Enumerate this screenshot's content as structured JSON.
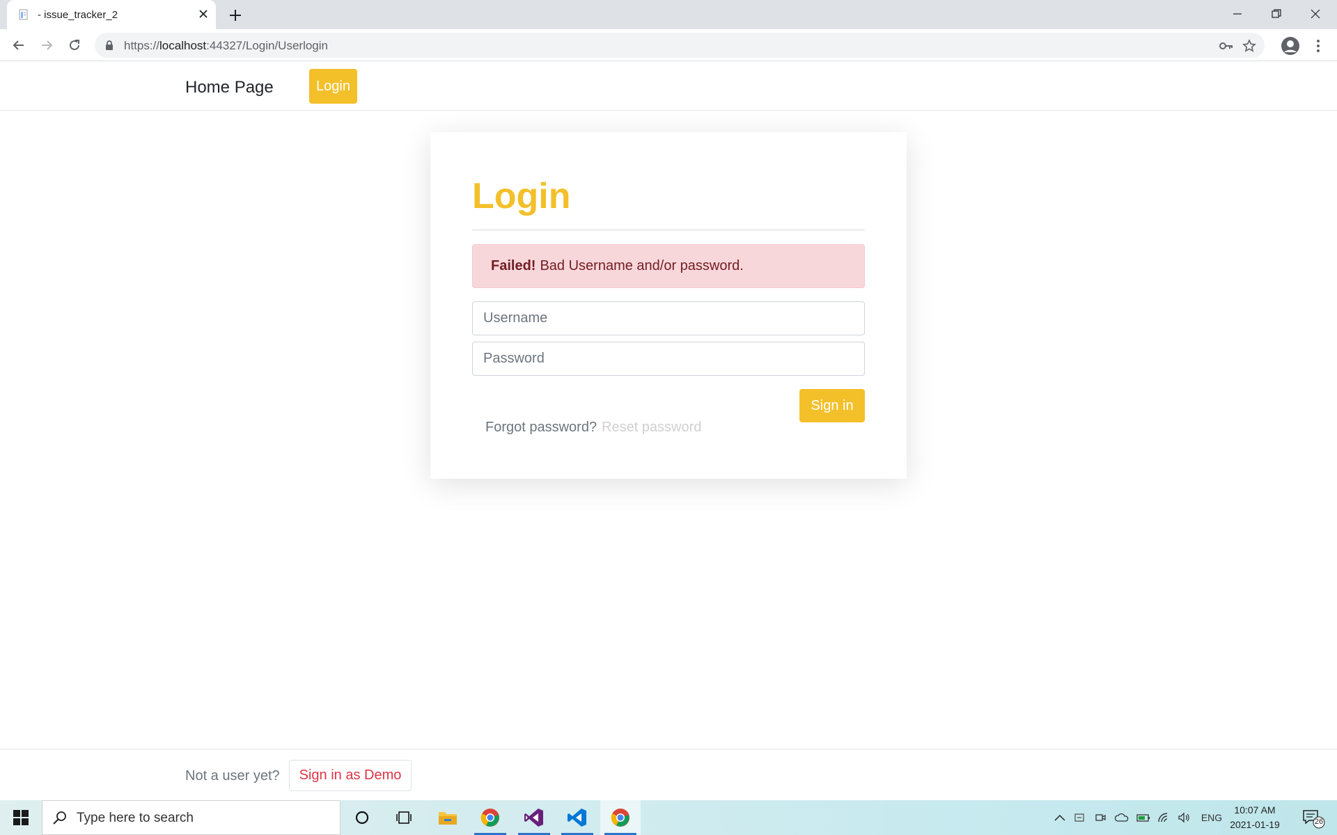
{
  "browser": {
    "tab_title": "- issue_tracker_2",
    "url_scheme": "https://",
    "url_host": "localhost",
    "url_rest": ":44327/Login/Userlogin"
  },
  "navbar": {
    "brand": "Home Page",
    "login_label": "Login"
  },
  "card": {
    "title": "Login",
    "alert_strong": "Failed!",
    "alert_text": "Bad Username and/or password.",
    "username_placeholder": "Username",
    "password_placeholder": "Password",
    "signin_label": "Sign in",
    "forgot_text": "Forgot password?",
    "reset_link": "Reset password"
  },
  "footer": {
    "text": "Not a user yet?",
    "demo_label": "Sign in as Demo"
  },
  "taskbar": {
    "search_placeholder": "Type here to search",
    "language": "ENG",
    "time": "10:07 AM",
    "date": "2021-01-19",
    "notification_count": "26"
  },
  "colors": {
    "accent": "#f3c02a",
    "alert_bg": "#f8d7da",
    "alert_text": "#721c24",
    "demo_text": "#dc3545"
  },
  "icons": [
    "document-icon",
    "close-icon",
    "plus-icon",
    "minimize-icon",
    "restore-icon",
    "window-close-icon",
    "back-arrow-icon",
    "forward-arrow-icon",
    "reload-icon",
    "lock-icon",
    "key-icon",
    "star-icon",
    "profile-icon",
    "kebab-menu-icon",
    "windows-logo-icon",
    "search-icon",
    "cortana-icon",
    "task-view-icon",
    "file-explorer-icon",
    "chrome-icon",
    "visual-studio-icon",
    "vscode-icon",
    "chevron-up-icon",
    "notification-icon"
  ]
}
